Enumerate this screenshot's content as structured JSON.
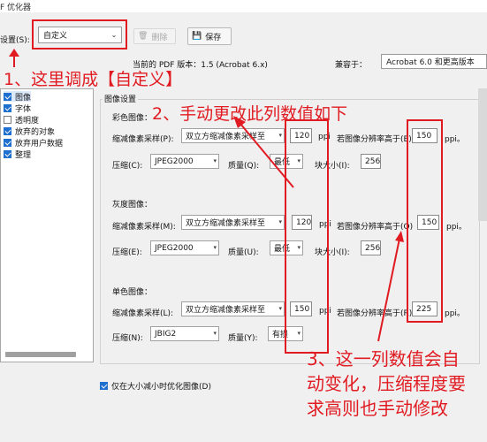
{
  "window": {
    "title": "F 优化器"
  },
  "settings": {
    "label": "设置(S):",
    "value": "自定义"
  },
  "toolbar": {
    "delete_label": "删除",
    "save_label": "保存"
  },
  "version": {
    "current_label": "当前的 PDF 版本：1.5 (Acrobat 6.x)",
    "compat_label": "兼容于：",
    "compat_value": "Acrobat 6.0 和更高版本"
  },
  "sidebar": {
    "items": [
      {
        "label": "图像",
        "checked": true
      },
      {
        "label": "字体",
        "checked": true
      },
      {
        "label": "透明度",
        "checked": false
      },
      {
        "label": "放弃的对象",
        "checked": true
      },
      {
        "label": "放弃用户数据",
        "checked": true
      },
      {
        "label": "整理",
        "checked": true
      }
    ]
  },
  "image_settings": {
    "group_title": "图像设置",
    "color": {
      "title": "彩色图像：",
      "downsample_label": "缩减像素采样(P):",
      "downsample_method": "双立方缩减像素采样至",
      "ppi_value": "120",
      "ppi_unit": "ppi",
      "threshold_label": "若图像分辨率高于(E)",
      "threshold_value": "150",
      "threshold_unit": "ppi。",
      "compression_label": "压缩(C):",
      "compression_value": "JPEG2000",
      "quality_label": "质量(Q):",
      "quality_value": "最低",
      "tile_label": "块大小(I):",
      "tile_value": "256"
    },
    "gray": {
      "title": "灰度图像：",
      "downsample_label": "缩减像素采样(M):",
      "downsample_method": "双立方缩减像素采样至",
      "ppi_value": "120",
      "ppi_unit": "ppi",
      "threshold_label": "若图像分辨率高于(O)",
      "threshold_value": "150",
      "threshold_unit": "ppi。",
      "compression_label": "压缩(E):",
      "compression_value": "JPEG2000",
      "quality_label": "质量(U):",
      "quality_value": "最低",
      "tile_label": "块大小(I):",
      "tile_value": "256"
    },
    "mono": {
      "title": "单色图像：",
      "downsample_label": "缩减像素采样(L):",
      "downsample_method": "双立方缩减像素采样至",
      "ppi_value": "150",
      "ppi_unit": "ppi",
      "threshold_label": "若图像分辨率高于(R)",
      "threshold_value": "225",
      "threshold_unit": "ppi。",
      "compression_label": "压缩(N):",
      "compression_value": "JBIG2",
      "quality_label": "质量(Y):",
      "quality_value": "有损"
    },
    "optimize_checkbox": "仅在大小减小时优化图像(D)"
  },
  "annotations": {
    "note1": "1、这里调成【自定义】",
    "note2": "2、手动更改此列数值如下",
    "note3_line1": "3、这一列数值会自",
    "note3_line2": "动变化，压缩程度要",
    "note3_line3": "求高则也手动修改",
    "color": "#e11b22"
  }
}
